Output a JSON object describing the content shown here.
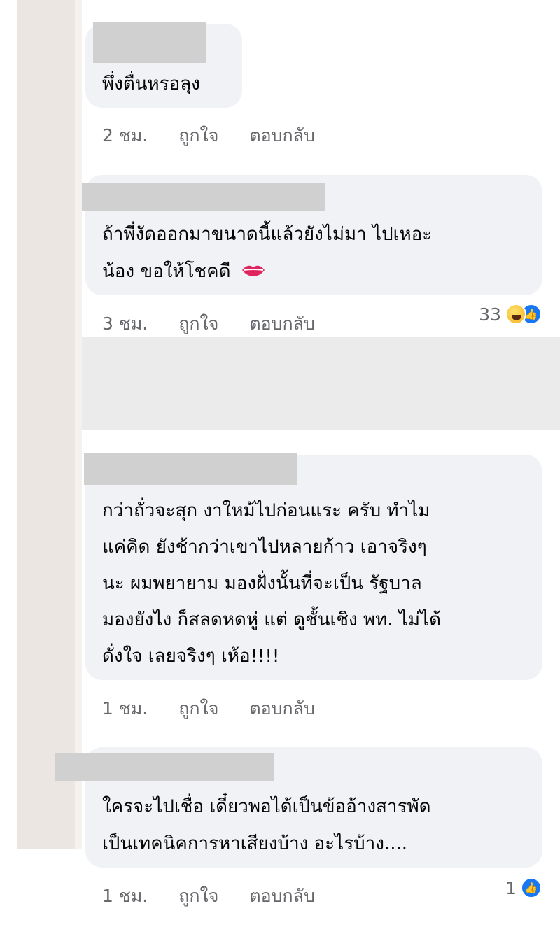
{
  "comments": [
    {
      "lines": [
        "พึ่งตื่นหรอลุง"
      ],
      "time": "2 ชม.",
      "like": "ถูกใจ",
      "reply": "ตอบกลับ",
      "reactions": null
    },
    {
      "lines": [
        "ถ้าพี่งัดออกมาขนาดนี้แล้วยังไม่มา ไปเหอะ",
        "น้อง ขอให้โชคดี"
      ],
      "time": "3 ชม.",
      "like": "ถูกใจ",
      "reply": "ตอบกลับ",
      "reactions": {
        "count": "33",
        "icons": [
          "laugh-emoji",
          "like-emoji"
        ]
      }
    },
    {
      "lines": [
        "กว่าถั่วจะสุก งาใหม้ไปก่อนแระ ครับ ทำไม",
        "แค่คิด ยังช้ากว่าเขาไปหลายก้าว เอาจริงๆ",
        "นะ ผมพยายาม มองฝั่งนั้นที่จะเป็น รัฐบาล",
        "มองยังไง ก็สลดหดหู่ แต่ ดูชั้นเชิง พท. ไม่ได้",
        "ดั่งใจ เลยจริงๆ เห้อ!!!!"
      ],
      "time": "1 ชม.",
      "like": "ถูกใจ",
      "reply": "ตอบกลับ",
      "reactions": null
    },
    {
      "lines": [
        "ใครจะไปเชื่อ เดี๋ยวพอได้เป็นข้ออ้างสารพัด",
        "เป็นเทคนิคการหาเสียงบ้าง อะไรบ้าง...."
      ],
      "time": "1 ชม.",
      "like": "ถูกใจ",
      "reply": "ตอบกลับ",
      "reactions": {
        "count": "1",
        "icons": [
          "like-emoji"
        ]
      }
    }
  ],
  "colors": {
    "bubble": "#f0f2f5",
    "meta": "#65676b",
    "like_blue": "#1877f2",
    "redaction": "#d0d0d0"
  }
}
